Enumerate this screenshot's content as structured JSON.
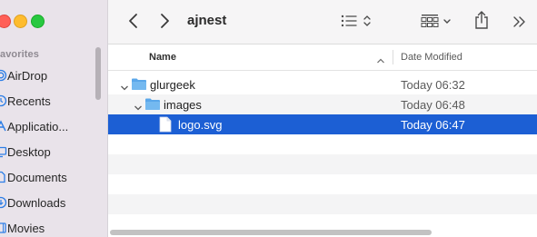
{
  "window": {
    "title": "ajnest"
  },
  "sidebar": {
    "section": "avorites",
    "items": [
      {
        "label": "AirDrop",
        "icon": "airdrop-icon"
      },
      {
        "label": "Recents",
        "icon": "clock-icon"
      },
      {
        "label": "Applicatio...",
        "icon": "applications-icon"
      },
      {
        "label": "Desktop",
        "icon": "desktop-icon"
      },
      {
        "label": "Documents",
        "icon": "document-icon"
      },
      {
        "label": "Downloads",
        "icon": "download-icon"
      },
      {
        "label": "Movies",
        "icon": "film-icon"
      }
    ]
  },
  "columns": {
    "name": "Name",
    "date": "Date Modified"
  },
  "rows": [
    {
      "name": "glurgeek",
      "date": "Today 06:32",
      "kind": "folder",
      "expanded": true
    },
    {
      "name": "images",
      "date": "Today 06:48",
      "kind": "folder",
      "expanded": true
    },
    {
      "name": "logo.svg",
      "date": "Today 06:47",
      "kind": "file",
      "selected": true
    }
  ],
  "colors": {
    "selection": "#1c5fd4",
    "folder": "#5aa7ea",
    "sidebar": "#e9e3ea"
  }
}
